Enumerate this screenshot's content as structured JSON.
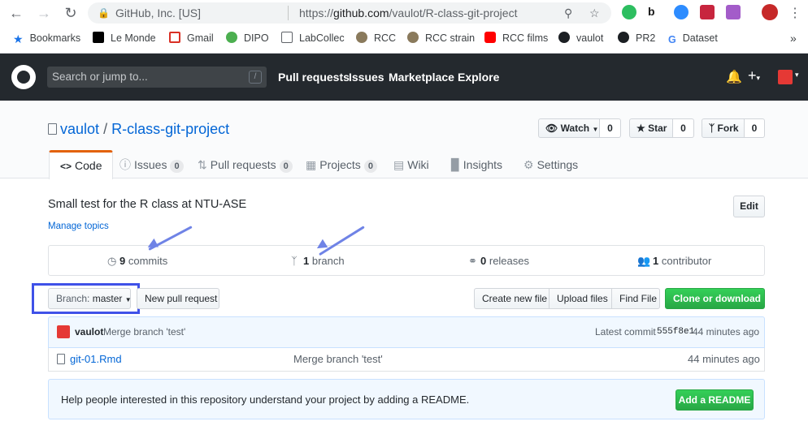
{
  "browser": {
    "site_name": "GitHub, Inc. [US]",
    "url_prefix": "https://",
    "url_host": "github.com",
    "url_path": "/vaulot/R-class-git-project",
    "bookmarks": [
      "Bookmarks",
      "Le Monde",
      "Gmail",
      "DIPO",
      "LabCollec",
      "RCC",
      "RCC strain",
      "RCC films",
      "vaulot",
      "PR2",
      "Dataset"
    ],
    "more": "»"
  },
  "header": {
    "search_placeholder": "Search or jump to...",
    "search_key": "/",
    "nav": [
      "Pull requests",
      "Issues",
      "Marketplace",
      "Explore"
    ]
  },
  "repo": {
    "owner": "vaulot",
    "separator": "/",
    "name": "R-class-git-project",
    "watch_label": "Watch",
    "watch_count": "0",
    "star_label": "Star",
    "star_count": "0",
    "fork_label": "Fork",
    "fork_count": "0"
  },
  "tabs": [
    {
      "label": "Code",
      "icon": "<>"
    },
    {
      "label": "Issues",
      "count": "0"
    },
    {
      "label": "Pull requests",
      "count": "0"
    },
    {
      "label": "Projects",
      "count": "0"
    },
    {
      "label": "Wiki"
    },
    {
      "label": "Insights"
    },
    {
      "label": "Settings"
    }
  ],
  "summary": {
    "description": "Small test for the R class at NTU-ASE",
    "manage_topics": "Manage topics",
    "edit_label": "Edit",
    "commits_count": "9",
    "commits_label": "commits",
    "branch_count": "1",
    "branch_label": "branch",
    "releases_count": "0",
    "releases_label": "releases",
    "contributor_count": "1",
    "contributor_label": "contributor"
  },
  "file_nav": {
    "branch_label": "Branch:",
    "branch_value": "master",
    "new_pr": "New pull request",
    "create_file": "Create new file",
    "upload_files": "Upload files",
    "find_file": "Find File",
    "clone": "Clone or download"
  },
  "commit": {
    "author": "vaulot",
    "message": "Merge branch 'test'",
    "latest_label": "Latest commit",
    "sha": "555f8e1",
    "age": "44 minutes ago"
  },
  "files": [
    {
      "name": "git-01.Rmd",
      "message": "Merge branch 'test'",
      "age": "44 minutes ago"
    }
  ],
  "readme_prompt": {
    "text": "Help people interested in this repository understand your project by adding a README.",
    "button": "Add a README"
  },
  "colors": {
    "accent_blue": "#0366d6",
    "header_bg": "#24292e",
    "green_button": "#2cbe4e",
    "tab_orange": "#e36209",
    "annotation": "#6f83e6"
  }
}
